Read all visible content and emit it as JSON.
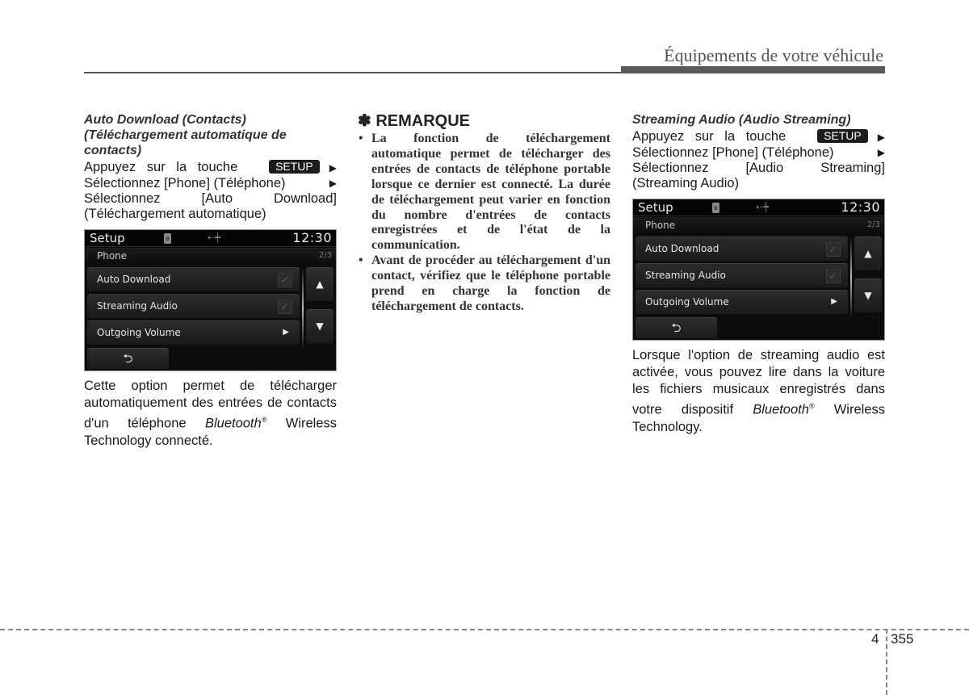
{
  "header": {
    "title": "Équipements de votre véhicule"
  },
  "left_column": {
    "subheading": [
      "Auto Download (Contacts)",
      "(Téléchargement automatique de",
      "contacts)"
    ],
    "instructions": {
      "line1_text": "Appuyez sur la touche",
      "setup_key": "SETUP",
      "line2_text": "Sélectionnez [Phone] (Téléphone)",
      "line3_a": "Sélectionnez",
      "line3_b": "[Auto",
      "line3_c": "Download]",
      "line4_text": "(Téléchargement automatique)"
    },
    "screen": {
      "title": "Setup",
      "bluetooth_icon": "bluetooth-icon",
      "usb_icon": "usb-icon",
      "time": "12:30",
      "section": "Phone",
      "page": "2/3",
      "rows": [
        {
          "label": "Auto Download",
          "control": "checkbox",
          "checked": true
        },
        {
          "label": "Streaming Audio",
          "control": "checkbox",
          "checked": true
        },
        {
          "label": "Outgoing Volume",
          "control": "arrow"
        }
      ],
      "up_glyph": "▲",
      "down_glyph": "▼",
      "back_glyph": "⮌"
    },
    "description": {
      "part1": "Cette option permet de télécharger automatiquement des entrées de contacts d'un téléphone",
      "brand": "Bluetooth",
      "reg": "®",
      "part2": "Wireless Technology connecté."
    }
  },
  "middle_column": {
    "remark_title": "✽ REMARQUE",
    "bullets": [
      "La fonction de téléchargement automatique permet de télécharger des entrées de contacts de téléphone portable lorsque ce dernier est connecté. La durée de téléchargement peut varier en fonction du nombre d'entrées de contacts enregistrées et de l'état de la communication.",
      "Avant de procéder au téléchargement d'un contact, vérifiez que le téléphone portable prend en charge la fonction de téléchargement de contacts."
    ]
  },
  "right_column": {
    "subheading": "Streaming Audio (Audio Streaming)",
    "instructions": {
      "line1_text": "Appuyez sur la touche",
      "setup_key": "SETUP",
      "line2_text": "Sélectionnez [Phone] (Téléphone)",
      "line3_a": "Sélectionnez",
      "line3_b": "[Audio",
      "line3_c": "Streaming]",
      "line4_text": "(Streaming Audio)"
    },
    "screen": {
      "title": "Setup",
      "time": "12:30",
      "section": "Phone",
      "page": "2/3",
      "rows": [
        {
          "label": "Auto Download",
          "control": "checkbox",
          "checked": true
        },
        {
          "label": "Streaming Audio",
          "control": "checkbox",
          "checked": true
        },
        {
          "label": "Outgoing Volume",
          "control": "arrow"
        }
      ],
      "up_glyph": "▲",
      "down_glyph": "▼",
      "back_glyph": "⮌"
    },
    "description": {
      "part1": "Lorsque l'option de streaming audio est activée, vous pouvez lire dans la voiture les fichiers musicaux enregistrés dans votre dispositif",
      "brand": "Bluetooth",
      "reg": "®",
      "part2": "Wireless Technology."
    }
  },
  "common": {
    "check_glyph": "✓",
    "arrow_glyph": "▶",
    "tri_glyph": "▶"
  },
  "footer": {
    "chapter": "4",
    "page": "355"
  }
}
